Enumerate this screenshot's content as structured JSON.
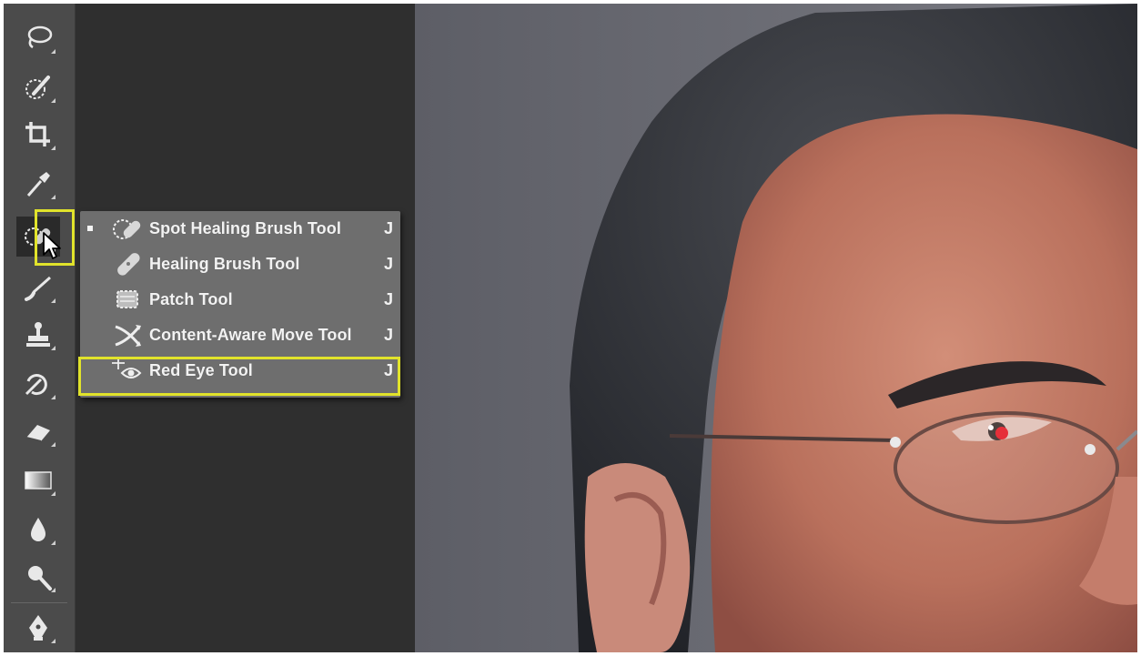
{
  "toolbar": {
    "tools": [
      {
        "icon": "lasso-icon"
      },
      {
        "icon": "quick-selection-icon"
      },
      {
        "icon": "crop-icon"
      },
      {
        "icon": "eyedropper-icon"
      },
      {
        "icon": "spot-healing-brush-icon",
        "selected": true
      },
      {
        "icon": "brush-icon"
      },
      {
        "icon": "clone-stamp-icon"
      },
      {
        "icon": "history-brush-icon"
      },
      {
        "icon": "eraser-icon"
      },
      {
        "icon": "gradient-icon"
      },
      {
        "icon": "blur-icon"
      },
      {
        "icon": "dodge-icon"
      },
      {
        "icon": "pen-icon"
      }
    ]
  },
  "flyout": {
    "items": [
      {
        "label": "Spot Healing Brush Tool",
        "shortcut": "J",
        "icon": "spot-healing-brush-icon",
        "active": true
      },
      {
        "label": "Healing Brush Tool",
        "shortcut": "J",
        "icon": "healing-brush-icon"
      },
      {
        "label": "Patch Tool",
        "shortcut": "J",
        "icon": "patch-icon"
      },
      {
        "label": "Content-Aware Move Tool",
        "shortcut": "J",
        "icon": "content-aware-move-icon"
      },
      {
        "label": "Red Eye Tool",
        "shortcut": "J",
        "icon": "red-eye-icon",
        "highlighted": true
      }
    ]
  },
  "colors": {
    "highlight": "#e1e32b",
    "toolbar_bg": "#4b4b4b",
    "flyout_bg": "#6e6e6e",
    "panel_bg": "#2f2f2f"
  }
}
